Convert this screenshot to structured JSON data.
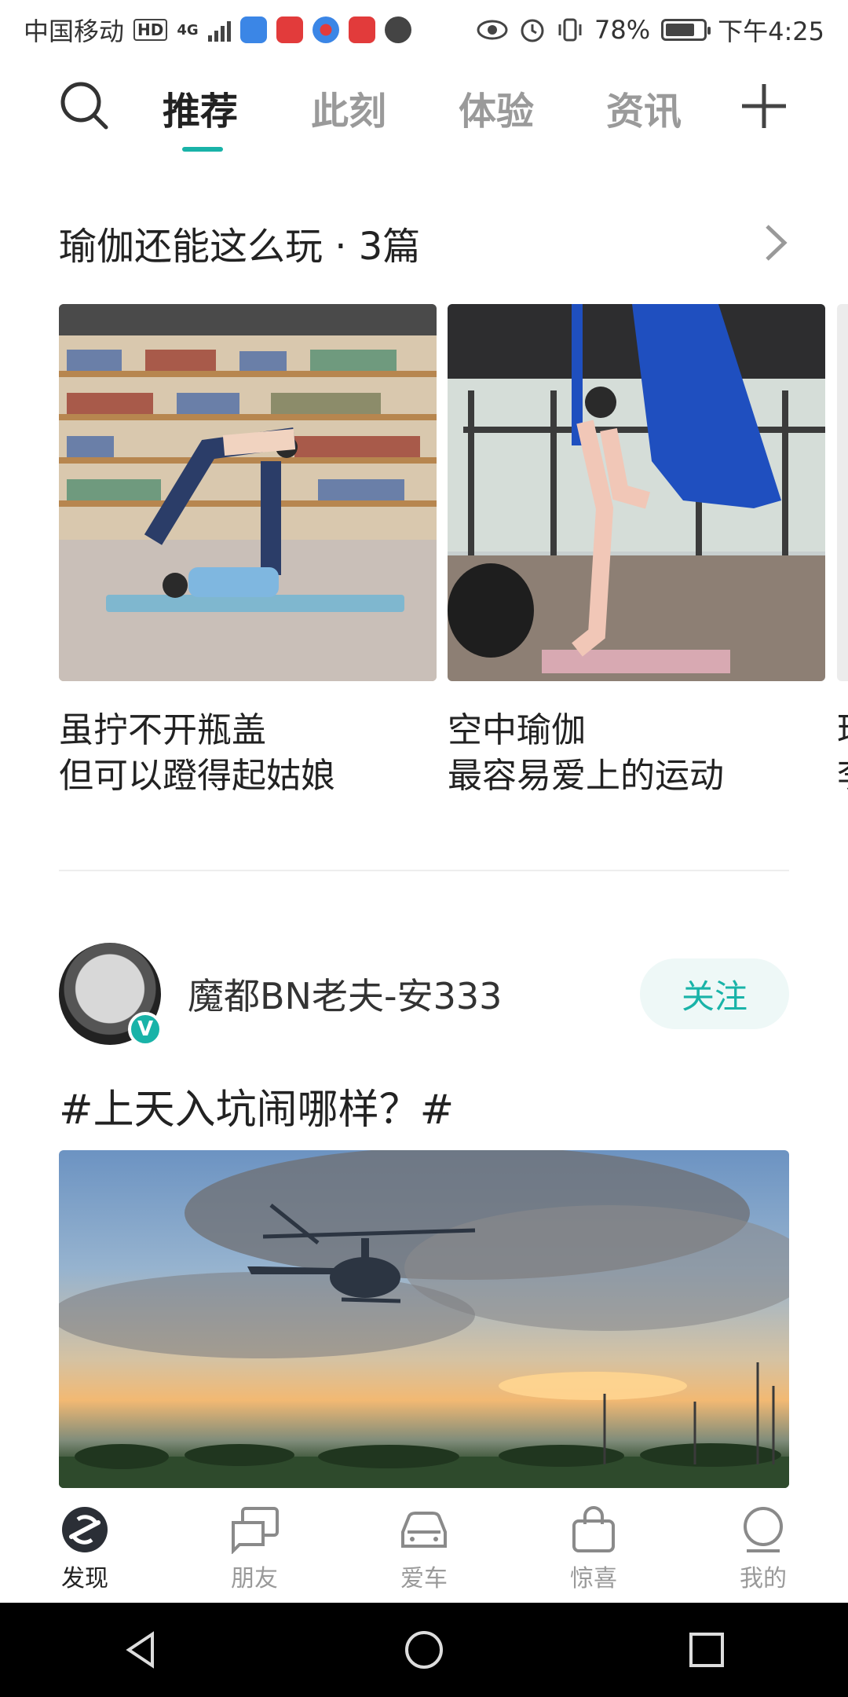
{
  "status_bar": {
    "carrier": "中国移动",
    "hd": "HD",
    "network": "4G",
    "battery": "78%",
    "battery_level": 0.78,
    "time": "下午4:25"
  },
  "tabs": [
    {
      "label": "推荐",
      "active": true
    },
    {
      "label": "此刻",
      "active": false
    },
    {
      "label": "体验",
      "active": false
    },
    {
      "label": "资讯",
      "active": false
    }
  ],
  "collection": {
    "title": "瑜伽还能这么玩 · 3篇",
    "cards": [
      {
        "line1": "虽拧不开瓶盖",
        "line2": "但可以蹬得起姑娘"
      },
      {
        "line1": "空中瑜伽",
        "line2": "最容易爱上的运动"
      },
      {
        "line1": "理",
        "line2": "李"
      }
    ]
  },
  "post": {
    "author": "魔都BN老夫-安333",
    "verified_badge": "V",
    "follow_label": "关注",
    "title": "#上天入坑闹哪样？#"
  },
  "bottom_nav": [
    {
      "label": "发现",
      "icon": "discover-icon",
      "active": true
    },
    {
      "label": "朋友",
      "icon": "friends-icon",
      "active": false
    },
    {
      "label": "爱车",
      "icon": "car-icon",
      "active": false
    },
    {
      "label": "惊喜",
      "icon": "bag-icon",
      "active": false
    },
    {
      "label": "我的",
      "icon": "profile-icon",
      "active": false
    }
  ],
  "colors": {
    "accent": "#19b3a8"
  }
}
